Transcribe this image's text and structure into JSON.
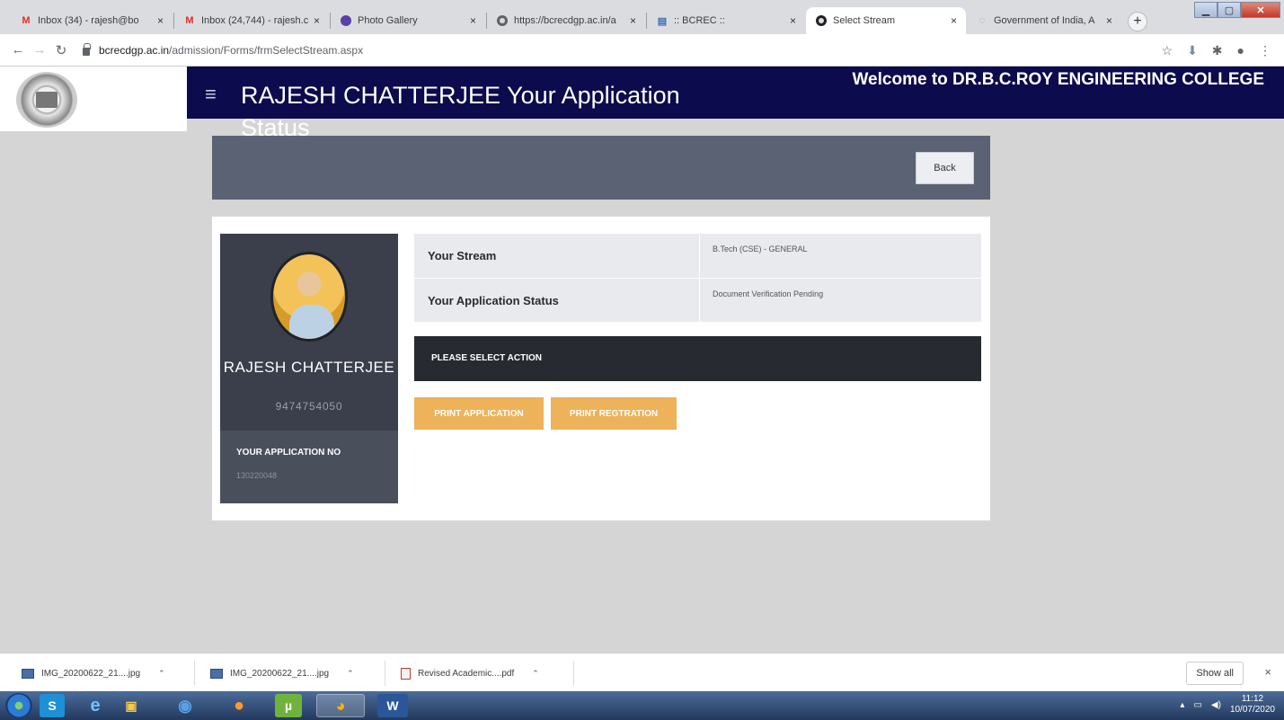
{
  "browser": {
    "tabs": [
      {
        "title": "Inbox (34) - rajesh@bo",
        "icon": "gmail-icon"
      },
      {
        "title": "Inbox (24,744) - rajesh.c",
        "icon": "gmail-icon"
      },
      {
        "title": "Photo Gallery",
        "icon": "photo-icon"
      },
      {
        "title": "https://bcrecdgp.ac.in/a",
        "icon": "globe-icon"
      },
      {
        "title": ":: BCREC ::",
        "icon": "page-icon"
      },
      {
        "title": "Select Stream",
        "icon": "globe-icon"
      },
      {
        "title": "Government of India, A",
        "icon": "loading-icon"
      }
    ],
    "close_glyph": "×",
    "new_tab_glyph": "+",
    "url_host": "bcrecdgp.ac.in",
    "url_path": "/admission/Forms/frmSelectStream.aspx"
  },
  "header": {
    "title": "RAJESH CHATTERJEE Your Application Status",
    "welcome": "Welcome to DR.B.C.ROY ENGINEERING COLLEGE",
    "menu_glyph": "≡"
  },
  "back_label": "Back",
  "profile": {
    "name": "RAJESH CHATTERJEE",
    "phone": "9474754050",
    "application_label": "YOUR APPLICATION NO",
    "application_no": "130220048"
  },
  "info": [
    {
      "label": "Your Stream",
      "value": "B.Tech (CSE) - GENERAL"
    },
    {
      "label": "Your Application Status",
      "value": "Document Verification Pending"
    }
  ],
  "action_heading": "PLEASE SELECT ACTION",
  "buttons": {
    "print_application": "PRINT APPLICATION",
    "print_registration": "PRINT REGTRATION"
  },
  "downloads": {
    "items": [
      {
        "name": "IMG_20200622_21....jpg",
        "type": "image"
      },
      {
        "name": "IMG_20200622_21....jpg",
        "type": "image"
      },
      {
        "name": "Revised Academic....pdf",
        "type": "pdf"
      }
    ],
    "show_all": "Show all"
  },
  "taskbar": {
    "time": "11:12",
    "date": "10/07/2020"
  },
  "colors": {
    "header_navy": "#0b0b4d",
    "panel_slate": "#5a6273",
    "profile_dark": "#3b3f4c",
    "action_dark": "#272a30",
    "button_orange": "#eeb25a"
  }
}
